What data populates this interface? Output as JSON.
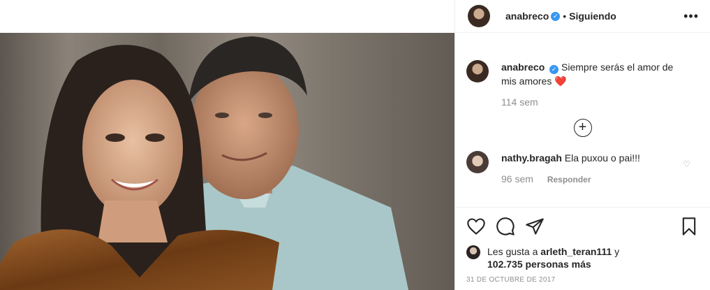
{
  "post": {
    "username": "anabreco",
    "verified_mark": "✓",
    "dot": "•",
    "follow_status": "Siguiendo",
    "more_icon": "more-horizontal-icon",
    "more_glyph": "•••"
  },
  "caption": {
    "username": "anabreco",
    "text": "Siempre serás el amor de mis amores ",
    "emoji": "❤️",
    "time": "114 sem"
  },
  "load_more": {
    "glyph": "+"
  },
  "comments": [
    {
      "username": "nathy.bragah",
      "text": "Ela puxou o pai!!!",
      "time": "96 sem",
      "reply": "Responder",
      "like_glyph": "♡"
    }
  ],
  "actions": {
    "like_icon": "heart-icon",
    "comment_icon": "comment-icon",
    "share_icon": "share-icon",
    "save_icon": "bookmark-icon"
  },
  "likes": {
    "prefix": "Les gusta a ",
    "user": "arleth_teran111",
    "mid": " y",
    "count": "102.735 personas más"
  },
  "date": "31 DE OCTUBRE DE 2017",
  "colors": {
    "verified": "#3897f0",
    "text": "#262626",
    "muted": "#8e8e8e",
    "border": "#efefef"
  }
}
